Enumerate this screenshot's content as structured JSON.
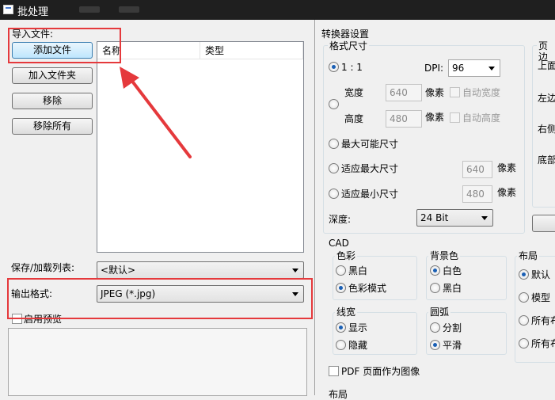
{
  "window": {
    "title": "批处理"
  },
  "left": {
    "import_label": "导入文件:",
    "buttons": {
      "add_file": "添加文件",
      "add_folder": "加入文件夹",
      "remove": "移除",
      "remove_all": "移除所有"
    },
    "file_list": {
      "columns": [
        "名称",
        "类型"
      ]
    },
    "save_load_label": "保存/加载列表:",
    "save_load_value": "<默认>",
    "output_format_label": "输出格式:",
    "output_format_value": "JPEG (*.jpg)",
    "preview_label": "启用预览"
  },
  "converter": {
    "title": "转换器设置",
    "format_size": {
      "title": "格式尺寸",
      "ratio_label": "1 : 1",
      "dpi_label": "DPI:",
      "dpi_value": "96",
      "width_label": "宽度",
      "width_value": "640",
      "height_label": "高度",
      "height_value": "480",
      "pixel_unit": "像素",
      "auto_width": "自动宽度",
      "auto_height": "自动高度",
      "max_possible": "最大可能尺寸",
      "fit_max": "适应最大尺寸",
      "fit_max_value": "640",
      "fit_min": "适应最小尺寸",
      "fit_min_value": "480",
      "depth_label": "深度:",
      "depth_value": "24 Bit"
    },
    "margins": {
      "title": "页边",
      "top": "上面",
      "left": "左边",
      "right": "右侧",
      "bottom": "底部"
    }
  },
  "cad": {
    "title": "CAD",
    "color": {
      "title": "色彩",
      "options": [
        "黑白",
        "色彩模式"
      ],
      "selected": 1
    },
    "background": {
      "title": "背景色",
      "options": [
        "白色",
        "黑白"
      ],
      "selected": 0
    },
    "layout": {
      "title": "布局",
      "options": [
        "默认",
        "模型",
        "所有布",
        "所有布"
      ],
      "selected": 0
    },
    "lineweight": {
      "title": "线宽",
      "options": [
        "显示",
        "隐藏"
      ],
      "selected": 0
    },
    "arc": {
      "title": "圆弧",
      "options": [
        "分割",
        "平滑"
      ],
      "selected": 1
    },
    "pdf_as_image": "PDF 页面作为图像",
    "bottom_partial": "布局"
  }
}
